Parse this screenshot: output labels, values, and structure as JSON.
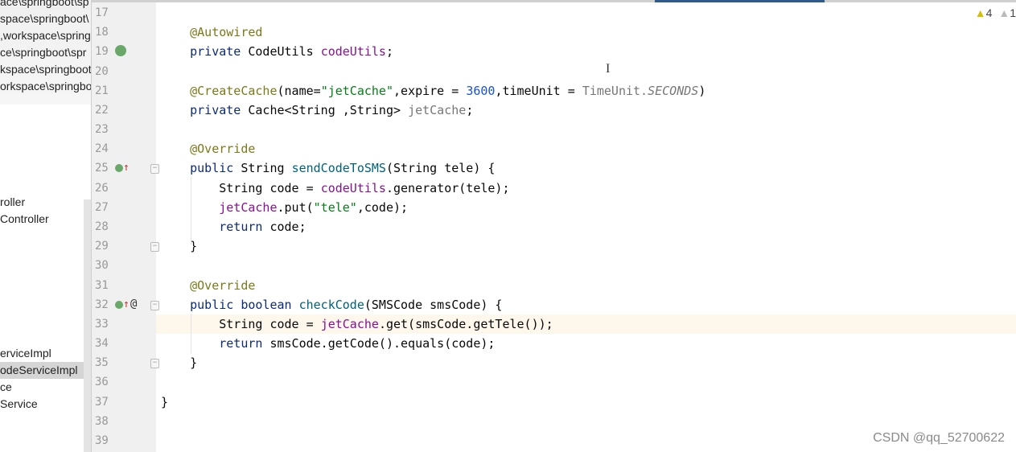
{
  "project_tree": {
    "items": [
      {
        "label": "ace\\springboot\\sp",
        "selected": false
      },
      {
        "label": "space\\springboot\\",
        "selected": false
      },
      {
        "label": ",workspace\\spring",
        "selected": false
      },
      {
        "label": "ce\\springboot\\spr",
        "selected": false
      },
      {
        "label": "kspace\\springboot",
        "selected": false
      },
      {
        "label": "orkspace\\springbo",
        "selected": false
      },
      {
        "label": "roller",
        "selected": false
      },
      {
        "label": "Controller",
        "selected": false
      },
      {
        "label": "erviceImpl",
        "selected": false
      },
      {
        "label": "odeServiceImpl",
        "selected": true
      },
      {
        "label": "ce",
        "selected": false
      },
      {
        "label": "Service",
        "selected": false
      },
      {
        "label": "",
        "selected": false
      }
    ]
  },
  "inspections": {
    "warnings": "4",
    "weak_warnings": "1",
    "warning_color": "#d4c000"
  },
  "watermark": "CSDN @qq_52700622",
  "current_line": 33,
  "editor": {
    "lines": [
      {
        "n": "17",
        "tokens": []
      },
      {
        "n": "18",
        "tokens": [
          [
            "    ",
            ""
          ],
          [
            "@Autowired",
            "ann"
          ]
        ]
      },
      {
        "n": "19",
        "icon": "bean-icon",
        "tokens": [
          [
            "    ",
            ""
          ],
          [
            "private",
            "kw"
          ],
          [
            " CodeUtils ",
            ""
          ],
          [
            "codeUtils",
            "fld"
          ],
          [
            ";",
            ""
          ]
        ]
      },
      {
        "n": "20",
        "tokens": []
      },
      {
        "n": "21",
        "tokens": [
          [
            "    ",
            ""
          ],
          [
            "@CreateCache",
            "ann"
          ],
          [
            "(name=",
            ""
          ],
          [
            "\"jetCache\"",
            "str"
          ],
          [
            ",expire = ",
            ""
          ],
          [
            "3600",
            "num"
          ],
          [
            ",timeUnit = ",
            ""
          ],
          [
            "TimeUnit.",
            "gray"
          ],
          [
            "SECONDS",
            "ital"
          ],
          [
            ")",
            ""
          ]
        ]
      },
      {
        "n": "22",
        "tokens": [
          [
            "    ",
            ""
          ],
          [
            "private",
            "kw"
          ],
          [
            " Cache<String ,String> ",
            ""
          ],
          [
            "jetCache",
            "gray"
          ],
          [
            ";",
            ""
          ]
        ]
      },
      {
        "n": "23",
        "tokens": []
      },
      {
        "n": "24",
        "tokens": [
          [
            "    ",
            ""
          ],
          [
            "@Override",
            "ann"
          ]
        ]
      },
      {
        "n": "25",
        "icon": "implements-icon",
        "fold": true,
        "tokens": [
          [
            "    ",
            ""
          ],
          [
            "public",
            "kw"
          ],
          [
            " String ",
            ""
          ],
          [
            "sendCodeToSMS",
            "mth"
          ],
          [
            "(String tele) {",
            ""
          ]
        ]
      },
      {
        "n": "26",
        "tokens": [
          [
            "        String code = ",
            ""
          ],
          [
            "codeUtils",
            "fld"
          ],
          [
            ".generator(tele);",
            ""
          ]
        ]
      },
      {
        "n": "27",
        "tokens": [
          [
            "        ",
            ""
          ],
          [
            "jetCache",
            "fld"
          ],
          [
            ".put(",
            ""
          ],
          [
            "\"tele\"",
            "str"
          ],
          [
            ",code);",
            ""
          ]
        ]
      },
      {
        "n": "28",
        "tokens": [
          [
            "        ",
            ""
          ],
          [
            "return",
            "kw"
          ],
          [
            " code;",
            ""
          ]
        ]
      },
      {
        "n": "29",
        "fold": true,
        "tokens": [
          [
            "    }",
            ""
          ]
        ]
      },
      {
        "n": "30",
        "tokens": []
      },
      {
        "n": "31",
        "tokens": [
          [
            "    ",
            ""
          ],
          [
            "@Override",
            "ann"
          ]
        ]
      },
      {
        "n": "32",
        "icon": "implements-icon",
        "at": "@",
        "fold": true,
        "tokens": [
          [
            "    ",
            ""
          ],
          [
            "public",
            "kw"
          ],
          [
            " ",
            ""
          ],
          [
            "boolean",
            "kw"
          ],
          [
            " ",
            ""
          ],
          [
            "checkCode",
            "mth"
          ],
          [
            "(SMSCode smsCode) {",
            ""
          ]
        ]
      },
      {
        "n": "33",
        "tokens": [
          [
            "        String code = ",
            ""
          ],
          [
            "jetCache",
            "fld"
          ],
          [
            ".get(smsCode.getTele());",
            ""
          ]
        ]
      },
      {
        "n": "34",
        "tokens": [
          [
            "        ",
            ""
          ],
          [
            "return",
            "kw"
          ],
          [
            " smsCode.getCode().equals(code);",
            ""
          ]
        ]
      },
      {
        "n": "35",
        "fold": true,
        "tokens": [
          [
            "    }",
            ""
          ]
        ]
      },
      {
        "n": "36",
        "tokens": []
      },
      {
        "n": "37",
        "tokens": [
          [
            "}",
            ""
          ]
        ]
      },
      {
        "n": "38",
        "tokens": []
      },
      {
        "n": "39",
        "tokens": []
      }
    ]
  }
}
